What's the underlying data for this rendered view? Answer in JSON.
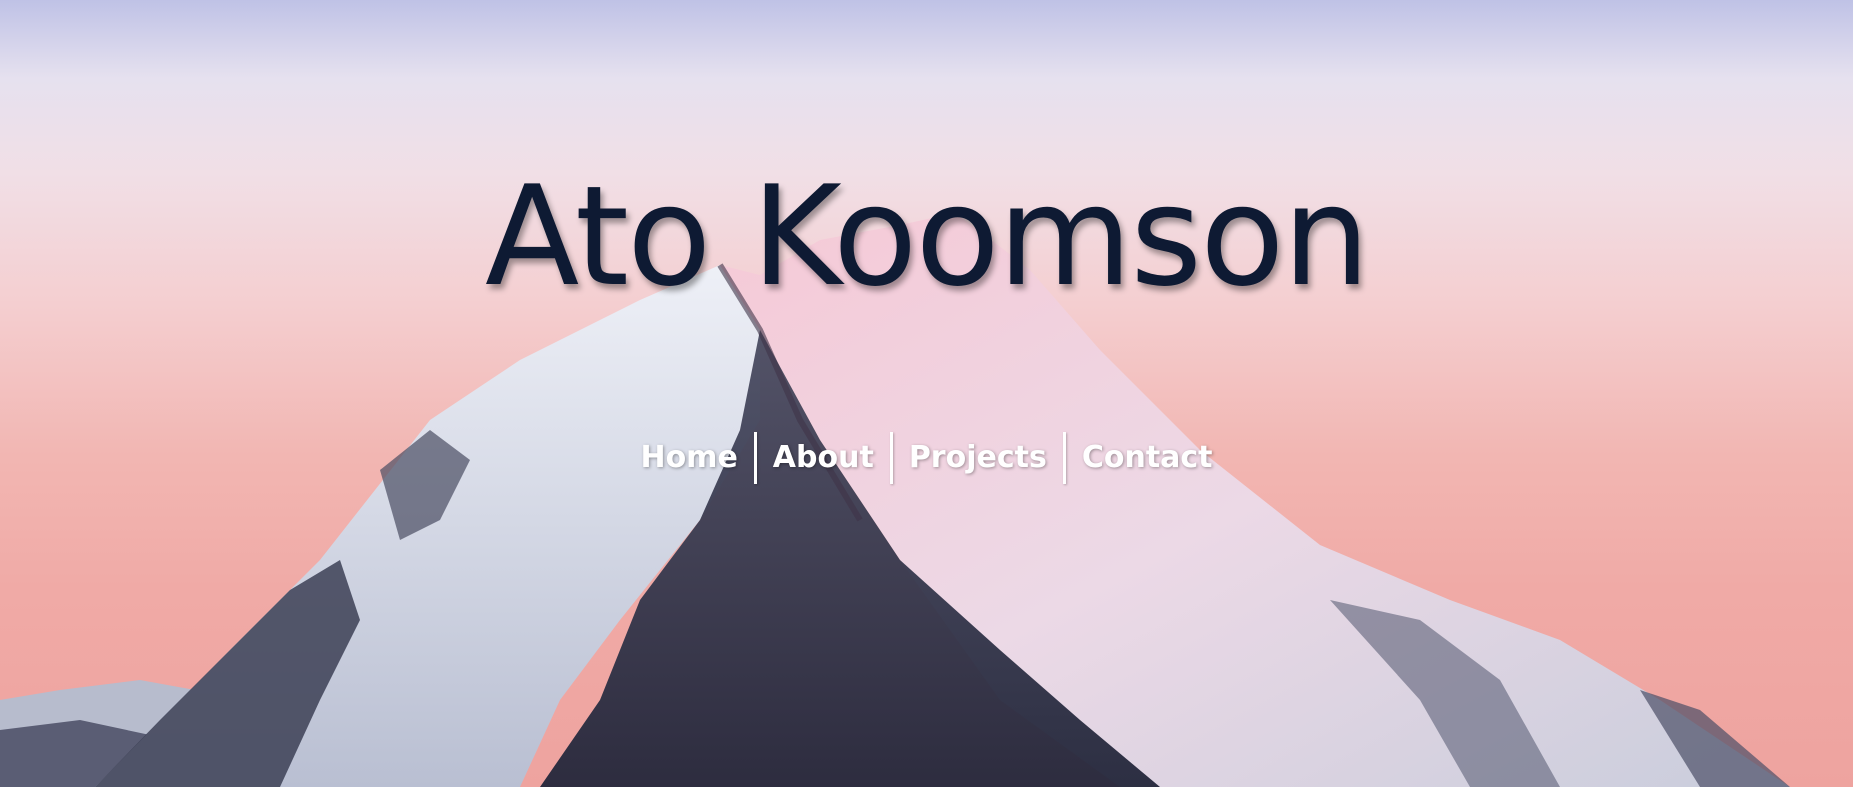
{
  "hero": {
    "title": "Ato Koomson",
    "background_colors": {
      "sky_top": "#bfc2e6",
      "sky_bottom": "#eea39f",
      "title_color": "#0e1a33",
      "nav_color": "#ffffff"
    }
  },
  "nav": {
    "items": [
      {
        "label": "Home"
      },
      {
        "label": "About"
      },
      {
        "label": "Projects"
      },
      {
        "label": "Contact"
      }
    ]
  }
}
